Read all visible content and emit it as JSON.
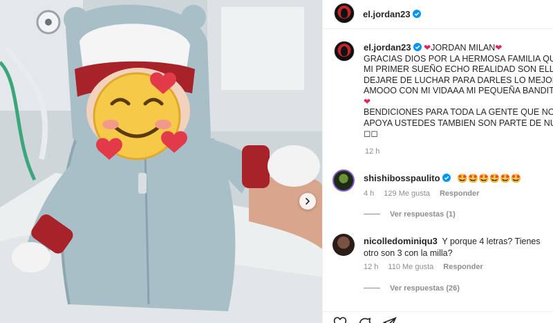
{
  "post": {
    "author": "el.jordan23",
    "caption_lines": [
      "GRACIAS DIOS POR LA HERMOSA FAMILIA QUE M",
      "MI PRIMER SUEÑO ECHO REALIDAD SON ELLOSD",
      "DEJARE DE LUCHAR PARA DARLES LO MEJOR QU",
      "AMOOO CON MI VIDAAA MI PEQUEÑA BANDITA"
    ],
    "caption_title": "JORDAN MILAN",
    "caption_blessing_lines": [
      "BENDICIONES PARA TODA LA GENTE QUE NOS C",
      "APOYA USTEDES TAMBIEN SON PARTE DE NUEST",
      "◻◻"
    ],
    "caption_time": "12 h"
  },
  "comments": [
    {
      "user": "shishibosspaulito",
      "text": "🤩🤩🤩🤩🤩🤩",
      "time": "4 h",
      "likes": "129 Me gusta",
      "reply_label": "Responder",
      "view_replies": "Ver respuestas (1)"
    },
    {
      "user": "nicolledominiqu3",
      "text": "Y porque 4 letras? Tienes otro son 3 con la milla?",
      "time": "12 h",
      "likes": "110 Me gusta",
      "reply_label": "Responder",
      "view_replies": "Ver respuestas (26)"
    }
  ],
  "icons": {
    "verified": "verified-badge-icon",
    "next": "chevron-right-icon",
    "like": "heart-outline-icon",
    "comment": "comment-icon",
    "share": "share-icon"
  },
  "colors": {
    "verified": "#0095f6",
    "heart": "#e0245e",
    "muted": "#8e8e8e"
  }
}
